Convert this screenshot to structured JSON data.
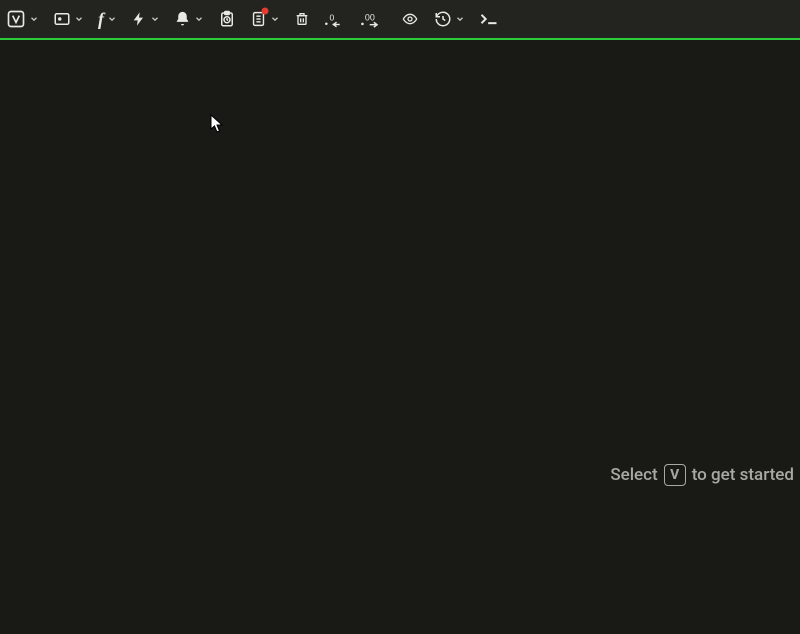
{
  "toolbar": {
    "items": [
      {
        "name": "brand-menu",
        "icon": "v-box",
        "has_dropdown": true
      },
      {
        "name": "panel-menu",
        "icon": "panel",
        "has_dropdown": true
      },
      {
        "name": "function-menu",
        "icon": "function",
        "has_dropdown": true
      },
      {
        "name": "actions-menu",
        "icon": "bolt",
        "has_dropdown": true
      },
      {
        "name": "alerts-menu",
        "icon": "bell",
        "has_dropdown": true
      },
      {
        "name": "clipboard-time",
        "icon": "clipboard-clock",
        "has_dropdown": false
      },
      {
        "name": "notes-menu",
        "icon": "notes",
        "has_dropdown": true,
        "badge": true
      },
      {
        "name": "delete",
        "icon": "trash",
        "has_dropdown": false
      },
      {
        "name": "decrease-decimal",
        "icon": "dec-decimal",
        "has_dropdown": false
      },
      {
        "name": "increase-decimal",
        "icon": "inc-decimal",
        "has_dropdown": false
      },
      {
        "name": "visibility",
        "icon": "eye",
        "has_dropdown": false
      },
      {
        "name": "history-menu",
        "icon": "history",
        "has_dropdown": true
      },
      {
        "name": "terminal",
        "icon": "terminal",
        "has_dropdown": false
      }
    ]
  },
  "hint": {
    "before": "Select",
    "key": "V",
    "after": "to get started"
  },
  "accent_color": "#2bcb3a"
}
